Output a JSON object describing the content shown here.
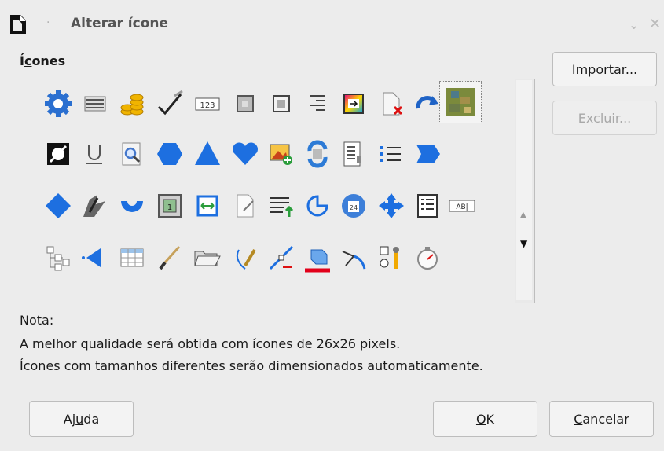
{
  "window": {
    "title": "Alterar ícone",
    "separator": "·",
    "minimize_glyph": "⌄",
    "close_glyph": "✕"
  },
  "icons_section": {
    "heading_prefix": "Í",
    "heading_accel": "c",
    "heading_suffix": "ones"
  },
  "icon_grid": {
    "rows": [
      [
        "settings-gear-icon",
        "list-icon",
        "coins-icon",
        "brush-check-icon",
        "number-123-icon",
        "frame-icon",
        "square-icon",
        "align-lines-icon",
        "gradient-arrow-icon",
        "document-delete-icon",
        "redo-arrow-icon",
        "image-thumbnail-icon"
      ],
      [
        "no-fill-icon",
        "underline-icon",
        "zoom-icon",
        "hexagon-icon",
        "triangle-icon",
        "heart-icon",
        "insert-image-icon",
        "refresh-icon",
        "document-list-icon",
        "bullet-list-icon",
        "chevron-shape-icon"
      ],
      [
        "diamond-icon",
        "shadow-brush-icon",
        "arc-icon",
        "zoom-page-icon",
        "fit-width-icon",
        "document-edit-icon",
        "insert-lines-icon",
        "pie-arc-icon",
        "calendar-gear-icon",
        "move-arrows-icon",
        "form-list-icon",
        "text-field-icon"
      ],
      [
        "tree-icon",
        "arrow-left-icon",
        "table-icon",
        "paint-brush-icon",
        "open-folder-icon",
        "pen-icon",
        "line-edit-icon",
        "box-red-bar-icon",
        "bezier-icon",
        "wrench-control-icon",
        "stopwatch-icon"
      ]
    ],
    "selected": "image-thumbnail-icon"
  },
  "scrollbar": {
    "up_glyph": "▲",
    "down_glyph": "▼"
  },
  "buttons": {
    "import": {
      "accel": "I",
      "rest": "mportar..."
    },
    "delete": {
      "label": "Excluir..."
    },
    "help": {
      "before": "Aj",
      "accel": "u",
      "after": "da"
    },
    "ok": {
      "accel": "O",
      "rest": "K"
    },
    "cancel": {
      "accel": "C",
      "rest": "ancelar"
    }
  },
  "note": {
    "title": "Nota:",
    "line1": "A melhor qualidade será obtida com ícones de 26x26 pixels.",
    "line2": "Ícones com tamanhos diferentes serão dimensionados automaticamente."
  }
}
